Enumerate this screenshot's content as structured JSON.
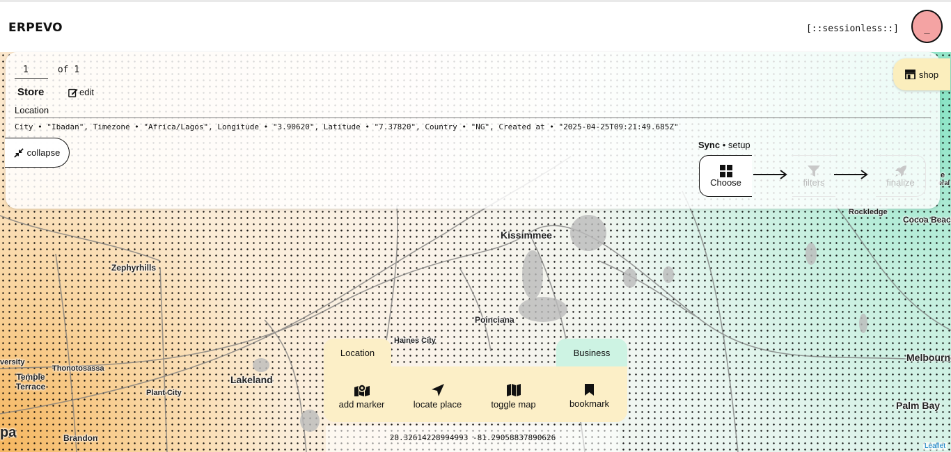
{
  "header": {
    "brand": "ERPEVO",
    "session": "[::sessionless::]",
    "avatar_glyph": "_",
    "avatar_color": "#f4a3a3"
  },
  "panel": {
    "pager": {
      "current": "1",
      "of_label": "of",
      "total": "1"
    },
    "store_title": "Store",
    "edit_label": "edit",
    "location_label": "Location",
    "location_details": "City • \"Ibadan\", Timezone • \"Africa/Lagos\", Longitude • \"3.90620\", Latitude • \"7.37820\", Country • \"NG\", Created at • \"2025-04-25T09:21:49.685Z\"",
    "collapse_label": "collapse",
    "shop_label": "shop"
  },
  "sync": {
    "title_bold": "Sync",
    "title_rest": " • setup",
    "steps": [
      {
        "label": "Choose",
        "icon": "grid-icon",
        "active": true
      },
      {
        "label": "filters",
        "icon": "filter-icon",
        "active": false
      },
      {
        "label": "finalize",
        "icon": "rocket-icon",
        "active": false
      }
    ]
  },
  "map": {
    "places": [
      "Kissimmee",
      "Zephyrhills",
      "Poinciana",
      "Haines City",
      "Lakeland",
      "Temple Terrace",
      "Thonotosassa",
      "Plant City",
      "Brandon",
      "versity",
      "pa",
      "Rockledge",
      "Cocoa Beach",
      "Melbourne",
      "Palm Bay",
      "e",
      "eral"
    ],
    "attribution": "Leaflet",
    "accent_mint": "#cdf3e3",
    "accent_cream": "#fcefc7"
  },
  "toolbar": {
    "tab_location": "Location",
    "tab_business": "Business",
    "tools": [
      {
        "label": "add marker",
        "icon": "map-marker-icon"
      },
      {
        "label": "locate place",
        "icon": "location-arrow-icon"
      },
      {
        "label": "toggle map",
        "icon": "map-icon"
      },
      {
        "label": "bookmark",
        "icon": "bookmark-icon"
      }
    ],
    "coords": "28.32614228994993 -81.29058837890626"
  }
}
